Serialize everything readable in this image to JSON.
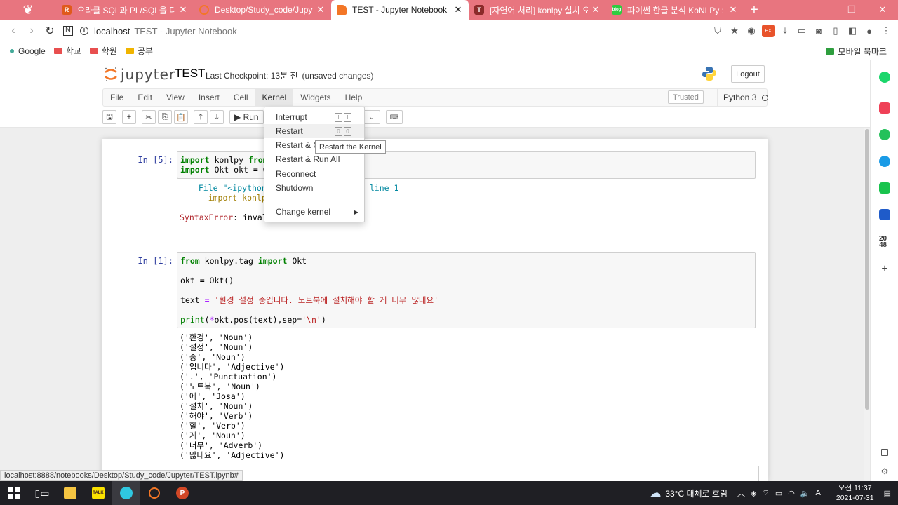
{
  "browser": {
    "tabs": [
      {
        "title": "오라클 SQL과 PL/SQL을 다루는",
        "icon_color": "#e05a1b",
        "icon_text": "R"
      },
      {
        "title": "Desktop/Study_code/Jupyter/",
        "icon_color": "#f37626",
        "icon_text": "◌"
      },
      {
        "title": "TEST - Jupyter Notebook",
        "icon_color": "#f37626",
        "icon_text": "◌",
        "active": true
      },
      {
        "title": "[자연어 처리] konlpy 설치 오류",
        "icon_color": "#8b2a2a",
        "icon_text": "T"
      },
      {
        "title": "파이썬 한글 분석 KoNLPy : 네이",
        "icon_color": "#2ecc40",
        "icon_text": "blog"
      }
    ],
    "close_glyph": "✕",
    "new_tab_glyph": "+",
    "address": {
      "host": "localhost",
      "page_title": "TEST - Jupyter Notebook"
    },
    "bookmarks": [
      {
        "label": "Google",
        "kind": "dot"
      },
      {
        "label": "학교",
        "kind": "folder"
      },
      {
        "label": "학원",
        "kind": "folder"
      },
      {
        "label": "공부",
        "kind": "folder-yellow"
      }
    ],
    "mobile_bookmarks": "모바일 북마크"
  },
  "jupyter": {
    "logo_text": "jupyter",
    "notebook_name": "TEST",
    "checkpoint": "Last Checkpoint: 13분 전",
    "unsaved": "(unsaved changes)",
    "logout": "Logout",
    "menus": [
      "File",
      "Edit",
      "View",
      "Insert",
      "Cell",
      "Kernel",
      "Widgets",
      "Help"
    ],
    "open_menu": "Kernel",
    "trusted": "Trusted",
    "kernel_name": "Python 3",
    "run_label": "Run",
    "kernel_menu": {
      "items": [
        {
          "label": "Interrupt",
          "keys": [
            "I",
            "I"
          ]
        },
        {
          "label": "Restart",
          "keys": [
            "0",
            "0"
          ]
        },
        {
          "label": "Restart & C"
        },
        {
          "label": "Restart & Run All"
        },
        {
          "label": "Reconnect"
        },
        {
          "label": "Shutdown"
        },
        {
          "label": "Change kernel"
        }
      ],
      "tooltip": "Restart the Kernel"
    },
    "cells": [
      {
        "prompt": "In [5]:",
        "code_lines": [
          "import konlpy from",
          "import Okt okt = Ok"
        ],
        "traceback": [
          "  File \"<ipython-i",
          "    import konlpy"
        ],
        "traceback_suffix": ", line 1",
        "error_name": "SyntaxError",
        "error_msg": ": invali"
      },
      {
        "prompt": "In [1]:",
        "code": {
          "l1_from": "from",
          "l1_mod": "konlpy.tag",
          "l1_import": "import",
          "l1_name": "Okt",
          "l2": "okt = Okt()",
          "l3_var": "text",
          "l3_eq": "=",
          "l3_str": "'환경 설정 중입니다. 노트북에 설치해야 할 게 너무 많네요'",
          "l4_print": "print",
          "l4_rest_a": "(",
          "l4_star": "*",
          "l4_rest_b": "okt.pos(text),sep=",
          "l4_sep": "'\\n'",
          "l4_close": ")"
        },
        "output": [
          "('환경', 'Noun')",
          "('설정', 'Noun')",
          "('중', 'Noun')",
          "('입니다', 'Adjective')",
          "('.', 'Punctuation')",
          "('노트북', 'Noun')",
          "('에', 'Josa')",
          "('설치', 'Noun')",
          "('해야', 'Verb')",
          "('할', 'Verb')",
          "('게', 'Noun')",
          "('너무', 'Adverb')",
          "('많네요', 'Adjective')"
        ]
      }
    ]
  },
  "status_url": "localhost:8888/notebooks/Desktop/Study_code/Jupyter/TEST.ipynb#",
  "taskbar": {
    "weather": "33°C  대체로 흐림",
    "time": "오전 11:37",
    "date": "2021-07-31"
  }
}
